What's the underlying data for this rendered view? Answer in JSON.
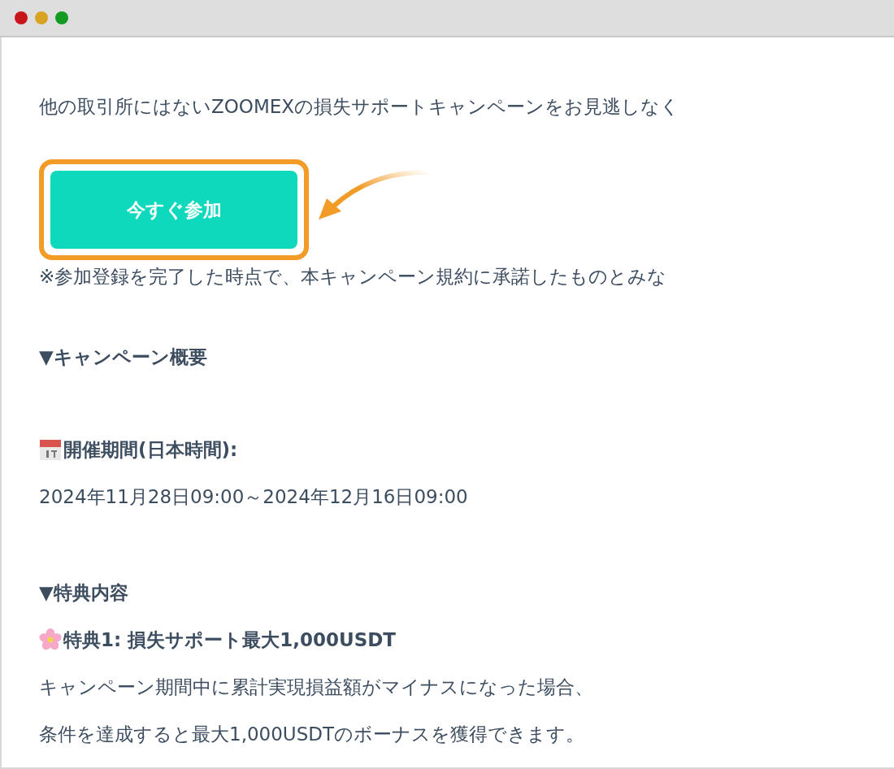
{
  "intro": "他の取引所にはないZOOMEXの損失サポートキャンペーンをお見逃しなく",
  "join_button": {
    "label": "今すぐ参加"
  },
  "note": "※参加登録を完了した時点で、本キャンペーン規約に承諾したものとみな",
  "overview": {
    "heading": "▼キャンペーン概要",
    "period_label": "開催期間(日本時間):",
    "period": "2024年11月28日09:00～2024年12月16日09:00"
  },
  "benefits": {
    "heading": "▼特典内容",
    "items": [
      {
        "title": "特典1: 損失サポート最大1,000USDT",
        "lines": [
          "キャンペーン期間中に累計実現損益額がマイナスになった場合、",
          "条件を達成すると最大1,000USDTのボーナスを獲得できます。"
        ]
      }
    ]
  }
}
